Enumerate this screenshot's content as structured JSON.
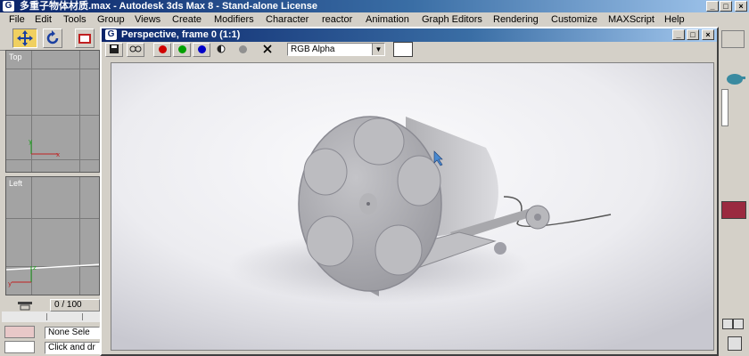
{
  "app": {
    "title": "多重子物体材质.max - Autodesk 3ds Max 8  - Stand-alone License",
    "logo_glyph": "G"
  },
  "menu": [
    "File",
    "Edit",
    "Tools",
    "Group",
    "Views",
    "Create",
    "Modifiers",
    "Character",
    "reactor",
    "Animation",
    "Graph Editors",
    "Rendering",
    "Customize",
    "MAXScript",
    "Help"
  ],
  "window_controls": {
    "minimize": "_",
    "maximize": "□",
    "close": "×"
  },
  "toolbar": {
    "move_icon": "move-icon",
    "rotate_icon": "rotate-icon",
    "scale_icon": "scale-icon"
  },
  "timeline": {
    "frame_label": "0 / 100"
  },
  "status": {
    "selection": "None Sele",
    "prompt": "Click and dr"
  },
  "render_window": {
    "title": "Perspective, frame 0 (1:1)",
    "channel_value": "RGB Alpha",
    "channel_options": [
      "RGB Alpha"
    ],
    "colors": {
      "red_channel": "#d00000",
      "green_channel": "#00a000",
      "blue_channel": "#0000c8"
    }
  }
}
